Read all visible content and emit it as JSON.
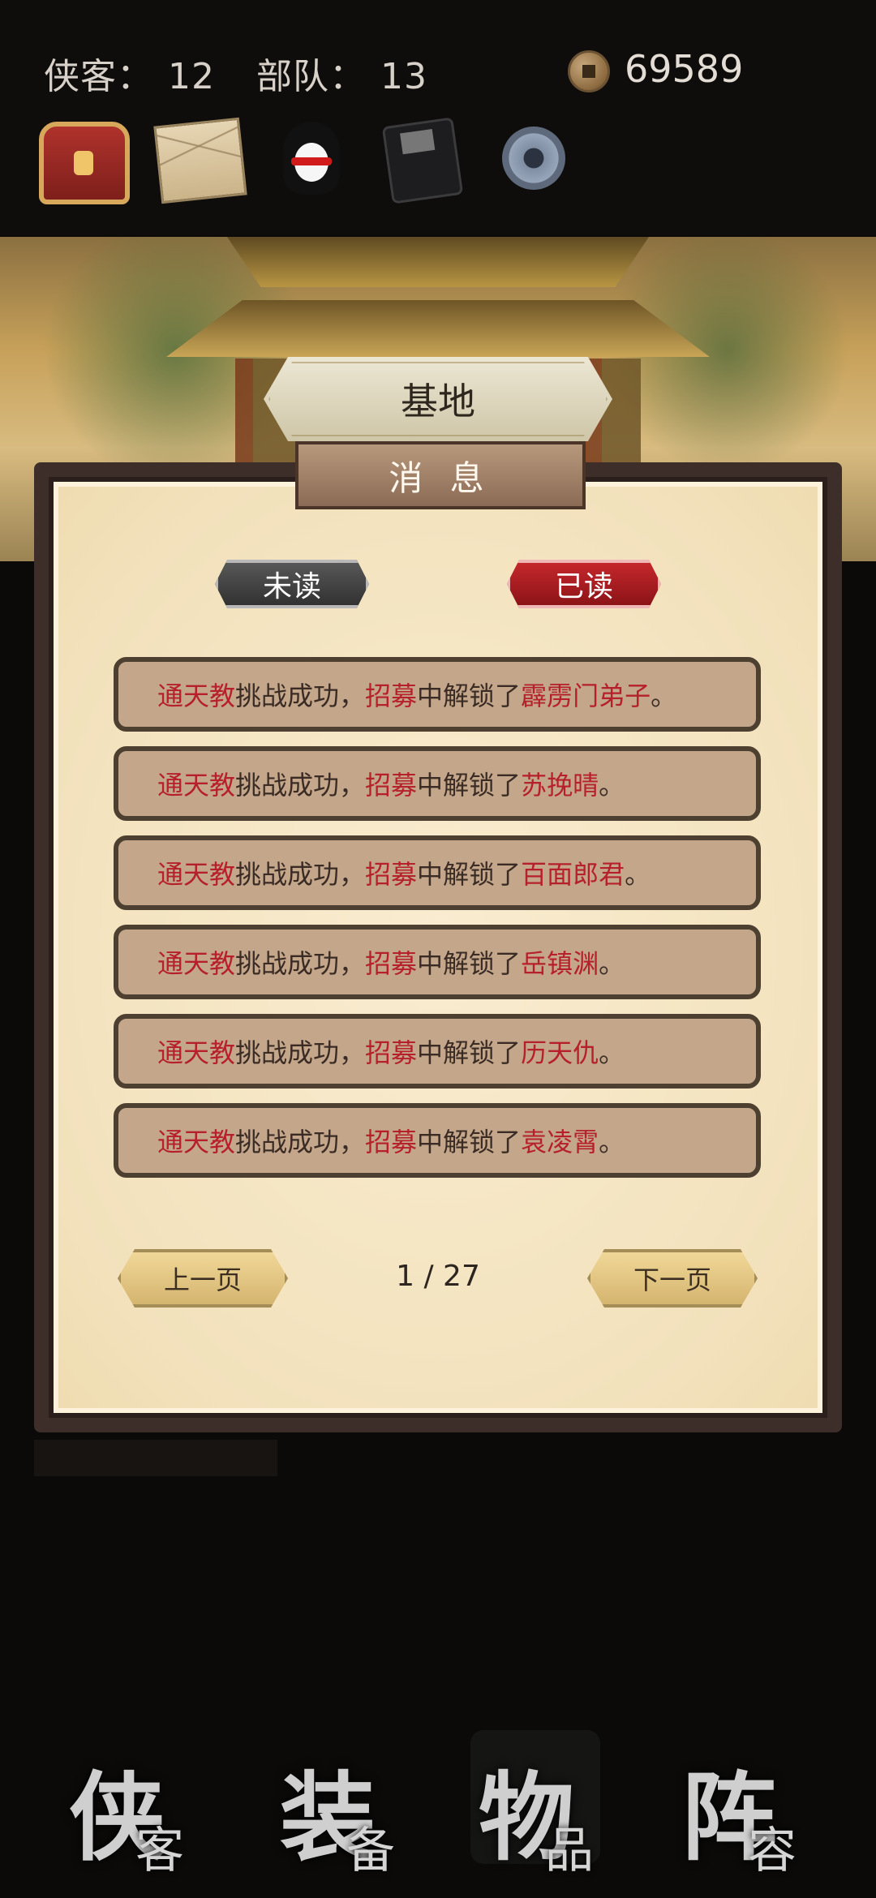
{
  "header": {
    "heroes_label": "侠客：",
    "heroes_value": "12",
    "troops_label": "部队：",
    "troops_value": "13",
    "coins": "69589",
    "icons": [
      "treasure-chest-icon",
      "mail-icon",
      "qq-penguin-icon",
      "save-disk-icon",
      "settings-gear-icon"
    ]
  },
  "location": {
    "title": "基地",
    "subtitle": "消 息"
  },
  "tabs": {
    "unread": "未读",
    "read": "已读",
    "active": "read"
  },
  "messages": [
    {
      "who": "通天教",
      "mid": "挑战成功，",
      "action": "招募",
      "mid2": "中解锁了",
      "target": "霹雳门弟子",
      "end": "。"
    },
    {
      "who": "通天教",
      "mid": "挑战成功，",
      "action": "招募",
      "mid2": "中解锁了",
      "target": "苏挽晴",
      "end": "。"
    },
    {
      "who": "通天教",
      "mid": "挑战成功，",
      "action": "招募",
      "mid2": "中解锁了",
      "target": "百面郎君",
      "end": "。"
    },
    {
      "who": "通天教",
      "mid": "挑战成功，",
      "action": "招募",
      "mid2": "中解锁了",
      "target": "岳镇渊",
      "end": "。"
    },
    {
      "who": "通天教",
      "mid": "挑战成功，",
      "action": "招募",
      "mid2": "中解锁了",
      "target": "历天仇",
      "end": "。"
    },
    {
      "who": "通天教",
      "mid": "挑战成功，",
      "action": "招募",
      "mid2": "中解锁了",
      "target": "袁凌霄",
      "end": "。"
    }
  ],
  "pagination": {
    "prev": "上一页",
    "page": "1 / 27",
    "next": "下一页"
  },
  "bottom_nav": [
    {
      "big": "侠",
      "small": "客"
    },
    {
      "big": "装",
      "small": "备"
    },
    {
      "big": "物",
      "small": "品"
    },
    {
      "big": "阵",
      "small": "容"
    }
  ],
  "colors": {
    "highlight": "#b6202a",
    "read_tab": "#c8292d",
    "unread_tab": "#3f3f3f"
  }
}
